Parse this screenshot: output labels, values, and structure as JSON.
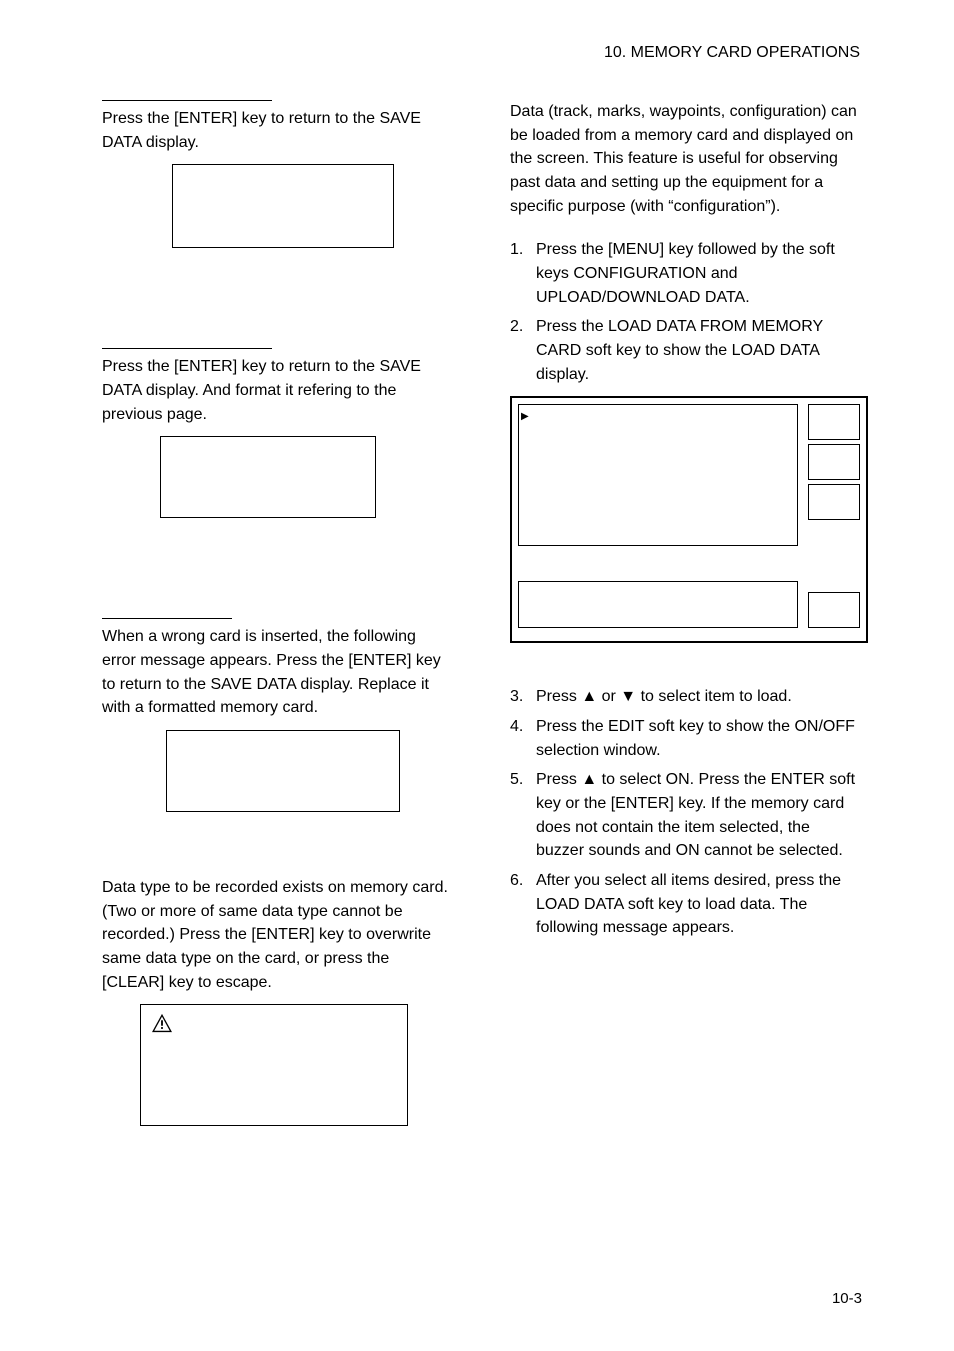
{
  "chapter_header": "10.  MEMORY  CARD  OPERATIONS",
  "left": {
    "para1": "Press the [ENTER] key to return to the SAVE DATA display.",
    "para2": "Press the [ENTER] key to return to the SAVE DATA display. And format it refering to the previous page.",
    "para3": "When a wrong card is inserted, the following error message appears. Press the [ENTER] key to return to the SAVE DATA display. Replace it with a formatted memory card.",
    "para4": "Data type to be recorded exists on memory card. (Two or more of same data type cannot be recorded.) Press the [ENTER] key to overwrite same data type on the card, or press the [CLEAR] key to escape."
  },
  "right": {
    "intro": "Data (track, marks, waypoints, configuration) can be loaded from a memory card and displayed on the screen. This feature is useful for observing past data and setting up the equipment for a specific purpose (with “configuration”).",
    "steps_a": [
      {
        "n": "1.",
        "t": "Press the [MENU] key followed by the soft keys CONFIGURATION and UPLOAD/DOWNLOAD DATA."
      },
      {
        "n": "2.",
        "t": "Press the LOAD DATA FROM MEMORY CARD soft key to show the LOAD DATA display."
      }
    ],
    "steps_b": [
      {
        "n": "3.",
        "t": "Press ▲ or ▼ to select item to load."
      },
      {
        "n": "4.",
        "t": "Press the EDIT soft key to show the ON/OFF selection window."
      },
      {
        "n": "5.",
        "t": "Press ▲ to select ON. Press the ENTER soft key or the [ENTER] key. If the memory card does not contain the item selected, the buzzer sounds and ON cannot be selected."
      },
      {
        "n": "6.",
        "t": "After you select all items desired, press the LOAD DATA soft key to load data. The following message appears."
      }
    ]
  },
  "page_number": "10-3"
}
